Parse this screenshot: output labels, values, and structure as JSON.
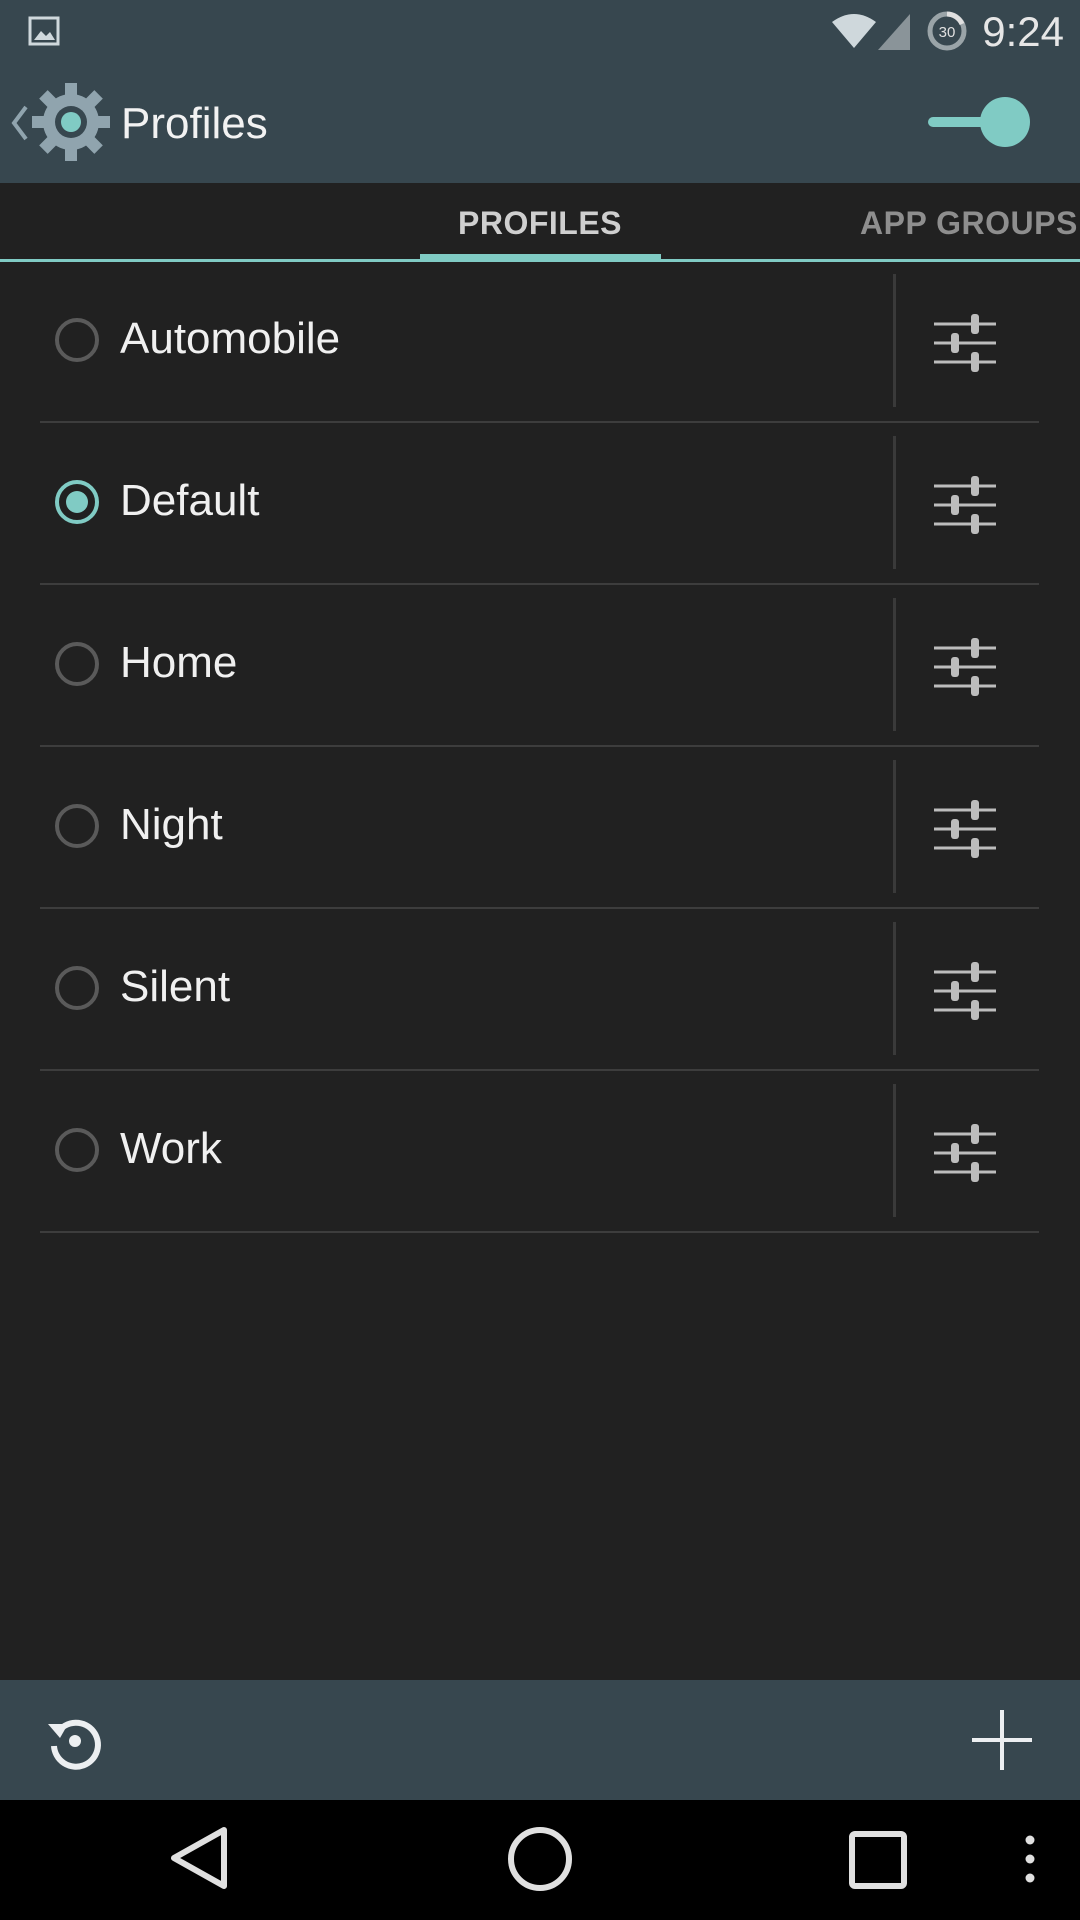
{
  "status_bar": {
    "time": "9:24",
    "battery_level": "30",
    "icons": [
      "gallery-notification-icon",
      "wifi-icon",
      "cell-signal-icon",
      "battery-icon"
    ]
  },
  "action_bar": {
    "title": "Profiles",
    "back_icon": "chevron-left-icon",
    "app_icon": "gear-icon",
    "master_switch_on": true
  },
  "tabs": [
    {
      "label": "PROFILES",
      "selected": true
    },
    {
      "label": "APP GROUPS",
      "selected": false
    }
  ],
  "profiles": [
    {
      "label": "Automobile",
      "selected": false
    },
    {
      "label": "Default",
      "selected": true
    },
    {
      "label": "Home",
      "selected": false
    },
    {
      "label": "Night",
      "selected": false
    },
    {
      "label": "Silent",
      "selected": false
    },
    {
      "label": "Work",
      "selected": false
    }
  ],
  "bottom_bar": {
    "left_icon": "reset-icon",
    "right_icon": "plus-icon"
  },
  "nav_bar": {
    "icons": [
      "back-triangle-icon",
      "home-circle-icon",
      "recents-square-icon",
      "overflow-menu-icon"
    ]
  },
  "colors": {
    "accent": "#80cbc4",
    "toolbar": "#37474f",
    "background": "#212121"
  }
}
